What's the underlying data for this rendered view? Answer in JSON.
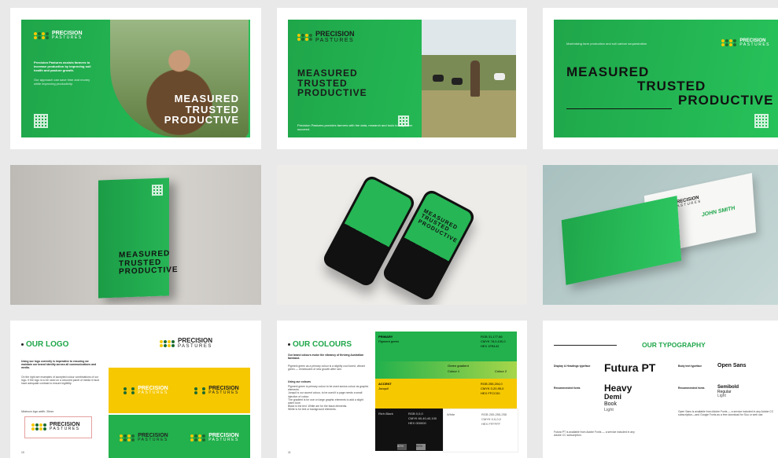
{
  "brand": {
    "name_top": "PRECISION",
    "name_bottom": "PASTURES",
    "green": "#22b14c",
    "yellow": "#f6c800",
    "dark": "#111111"
  },
  "slide1": {
    "intro": "Precision Pastures assists farmers to increase production by improving soil health and pasture growth.",
    "body": "Our approach can save time and money while improving productivity.",
    "lines": [
      "MEASURED",
      "TRUSTED",
      "PRODUCTIVE"
    ]
  },
  "slide2": {
    "lines": [
      "MEASURED",
      "TRUSTED",
      "PRODUCTIVE"
    ],
    "footnote": "Precision Pastures provides farmers with the data, research and tools to help them succeed."
  },
  "slide3": {
    "lines": [
      "MEASURED",
      "TRUSTED",
      "PRODUCTIVE"
    ],
    "caption": "Maximising farm production and soil carbon sequestration"
  },
  "book": {
    "lines": [
      "MEASURED",
      "TRUSTED",
      "PRODUCTIVE"
    ]
  },
  "phones": {
    "screen_lines": [
      "MEASURED",
      "TRUSTED",
      "PRODUCTIVE"
    ]
  },
  "card": {
    "person": "JOHN SMITH"
  },
  "logo_page": {
    "title": "OUR LOGO",
    "intro": "Using our logo correctly is imperative to ensuring we maintain our brand identity across all communications and media.",
    "body": "On the right are examples of accepted colour combinations of our logo. If the logo is to be used on a coloured panel of media it must have adequate contrast to ensure legibility.",
    "min_size": "Minimum logo width: 30mm",
    "page": "10"
  },
  "colours_page": {
    "title": "OUR COLOURS",
    "intro": "Our brand colours evoke the vibrancy of thriving Australian farmland.",
    "body": "Pigment green as a primary colour is a slightly cool toned, vibrant green — reminiscent of new growth after rain.",
    "using": "Using our colours",
    "rules": [
      "Pigment green is primary colour to be used across colour as graphic elements.",
      "Jonquil is our accent colour, to be used if a page needs a small injection of colour.",
      "The gradient is for use on large graphic elements to add a slight warm tone.",
      "Black is the text. White are for the black elements.",
      "White is for text or background elements."
    ],
    "primary_label": "PRIMARY",
    "primary_name": "Pigment green",
    "primary_rgb": "RGB  31,177,66",
    "primary_cmyk": "CMYK  78,0,100,0",
    "primary_hex": "HEX  1FB142",
    "gradient_label": "Green gradient",
    "colour1": "Colour 1",
    "colour2": "Colour 2",
    "accent_label": "ACCENT",
    "accent_name": "Jonquil",
    "accent_rgb": "RGB  255,204,0",
    "accent_cmyk": "CMYK  0,20,95,0",
    "accent_hex": "HEX  FFCC00",
    "black_name": "Rich Black",
    "black_rgb": "RGB  0,0,0",
    "black_cmyk": "CMYK  60,40,40,100",
    "black_hex": "HEX  000000",
    "white_name": "White",
    "white_rgb": "RGB  255,255,255",
    "white_cmyk": "CMYK  0,0,0,0",
    "white_hex": "HEX  FFFFFF",
    "tint1": "80%",
    "tint2": "50%",
    "page": "11"
  },
  "type_page": {
    "title": "OUR TYPOGRAPHY",
    "display_label": "Display & Headings typeface",
    "display_font": "Futura PT",
    "body_label": "Body text typeface",
    "body_font": "Open Sans",
    "recommended": "Recommended fonts",
    "recommended2": "Recommended fonts",
    "futura_weights": [
      "Heavy",
      "Demi",
      "Book",
      "Light"
    ],
    "open_weights": [
      "Semibold",
      "Regular",
      "Light"
    ],
    "futura_note": "Futura PT is available from Adobe Fonts — a service included in any Adobe CC subscription.",
    "open_note": "Open Sans is available from Adobe Fonts — a service included in any Adobe CC subscription—and Google Fonts as a free download for Sou or web use."
  }
}
